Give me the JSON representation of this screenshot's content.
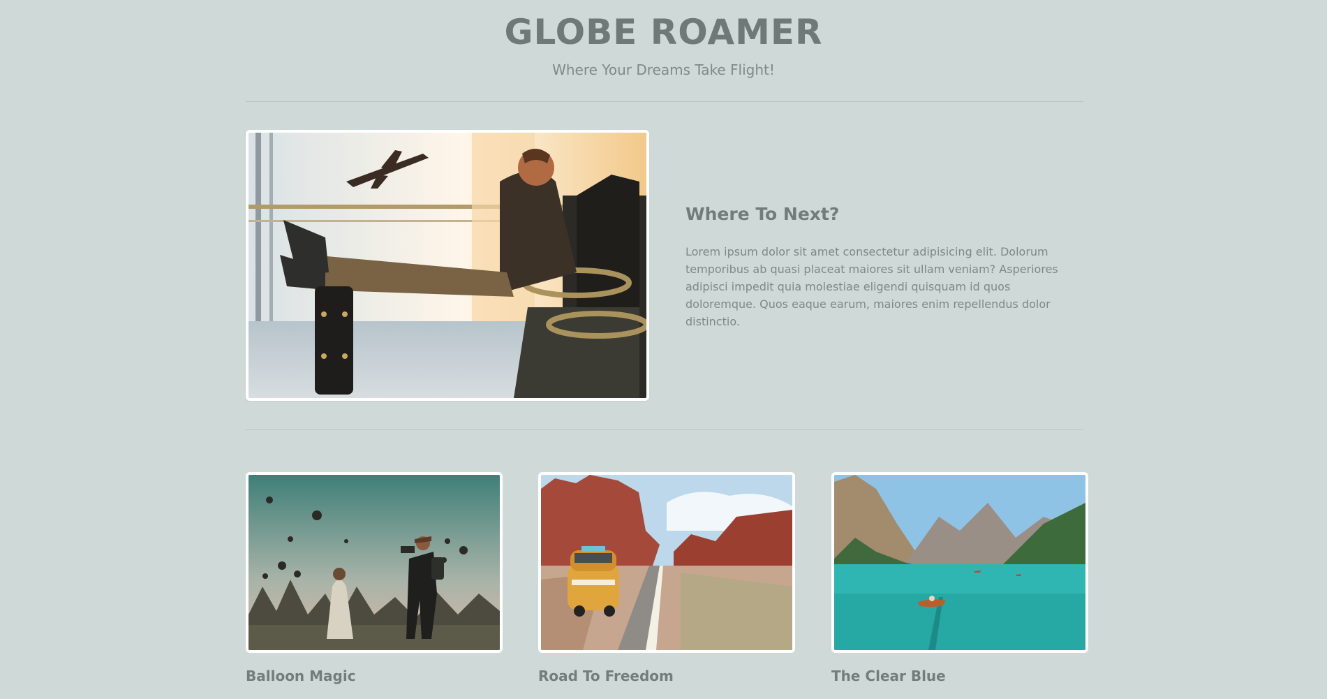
{
  "header": {
    "title": "GLOBE ROAMER",
    "tagline": "Where Your Dreams Take Flight!"
  },
  "hero": {
    "image_icon": "traveler-airport-photo",
    "heading": "Where To Next?",
    "body": "Lorem ipsum dolor sit amet consectetur adipisicing elit. Dolorum temporibus ab quasi placeat maiores sit ullam veniam? Asperiores adipisci impedit quia molestiae eligendi quisquam id quos doloremque. Quos eaque earum, maiores enim repellendus dolor distinctio."
  },
  "cards": [
    {
      "title": "Balloon Magic",
      "image_icon": "hot-air-balloons-photo"
    },
    {
      "title": "Road To Freedom",
      "image_icon": "desert-road-van-photo"
    },
    {
      "title": "The Clear Blue",
      "image_icon": "mountain-lake-boat-photo"
    }
  ],
  "colors": {
    "background": "#cfdad8",
    "heading": "#6f7a78",
    "text": "#7e8886",
    "frame": "#ffffff"
  }
}
